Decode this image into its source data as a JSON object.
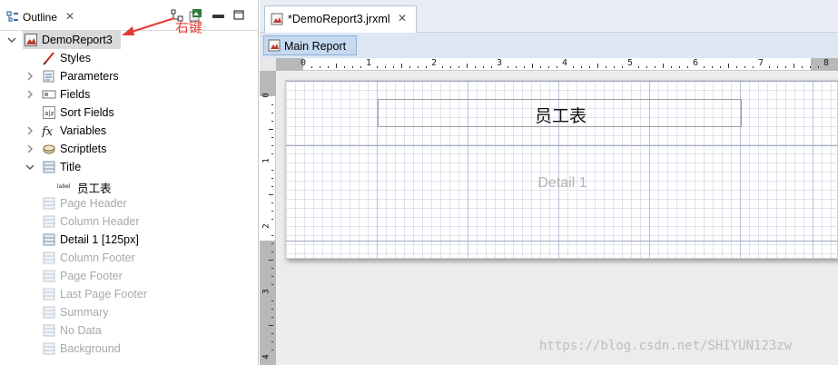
{
  "outline": {
    "title": "Outline",
    "close_glyph": "✕",
    "annotation": "右键",
    "tree": [
      {
        "label": "DemoReport3",
        "icon": "report-icon",
        "twisty": "expanded",
        "level": 0,
        "dim": false
      },
      {
        "label": "Styles",
        "icon": "brush-icon",
        "twisty": "none",
        "level": 1,
        "dim": false
      },
      {
        "label": "Parameters",
        "icon": "parameters-icon",
        "twisty": "collapsed",
        "level": 1,
        "dim": false
      },
      {
        "label": "Fields",
        "icon": "fields-icon",
        "twisty": "collapsed",
        "level": 1,
        "dim": false
      },
      {
        "label": "Sort Fields",
        "icon": "sort-fields-icon",
        "twisty": "none",
        "level": 1,
        "dim": false
      },
      {
        "label": "Variables",
        "icon": "fx-icon",
        "twisty": "collapsed",
        "level": 1,
        "dim": false
      },
      {
        "label": "Scriptlets",
        "icon": "scriptlets-icon",
        "twisty": "collapsed",
        "level": 1,
        "dim": false
      },
      {
        "label": "Title",
        "icon": "band-icon",
        "twisty": "expanded",
        "level": 1,
        "dim": false
      },
      {
        "label": "员工表",
        "icon": "label-icon",
        "icon_text": "label",
        "twisty": "none",
        "level": 2,
        "dim": false
      },
      {
        "label": "Page Header",
        "icon": "band-icon",
        "twisty": "none",
        "level": 1,
        "dim": true
      },
      {
        "label": "Column Header",
        "icon": "band-icon",
        "twisty": "none",
        "level": 1,
        "dim": true
      },
      {
        "label": "Detail 1 [125px]",
        "icon": "band-icon",
        "twisty": "none",
        "level": 1,
        "dim": false
      },
      {
        "label": "Column Footer",
        "icon": "band-icon",
        "twisty": "none",
        "level": 1,
        "dim": true
      },
      {
        "label": "Page Footer",
        "icon": "band-icon",
        "twisty": "none",
        "level": 1,
        "dim": true
      },
      {
        "label": "Last Page Footer",
        "icon": "band-icon",
        "twisty": "none",
        "level": 1,
        "dim": true
      },
      {
        "label": "Summary",
        "icon": "band-icon",
        "twisty": "none",
        "level": 1,
        "dim": true
      },
      {
        "label": "No Data",
        "icon": "band-icon",
        "twisty": "none",
        "level": 1,
        "dim": true
      },
      {
        "label": "Background",
        "icon": "band-icon",
        "twisty": "none",
        "level": 1,
        "dim": true
      }
    ]
  },
  "editor": {
    "tab_label": "*DemoReport3.jrxml",
    "tab_close": "✕",
    "subtab_label": "Main Report",
    "ruler_numbers": [
      "0",
      "1",
      "2",
      "3",
      "4",
      "5",
      "6",
      "7",
      "8"
    ],
    "vruler_numbers": [
      "0",
      "1",
      "2",
      "3",
      "4"
    ],
    "title_text": "员工表",
    "detail_label": "Detail 1"
  },
  "watermark": "https://blog.csdn.net/SHIYUN123zw",
  "colors": {
    "annotation": "#e53b35",
    "selection": "#d9d9d9",
    "dim_text": "#a8a8a8"
  }
}
